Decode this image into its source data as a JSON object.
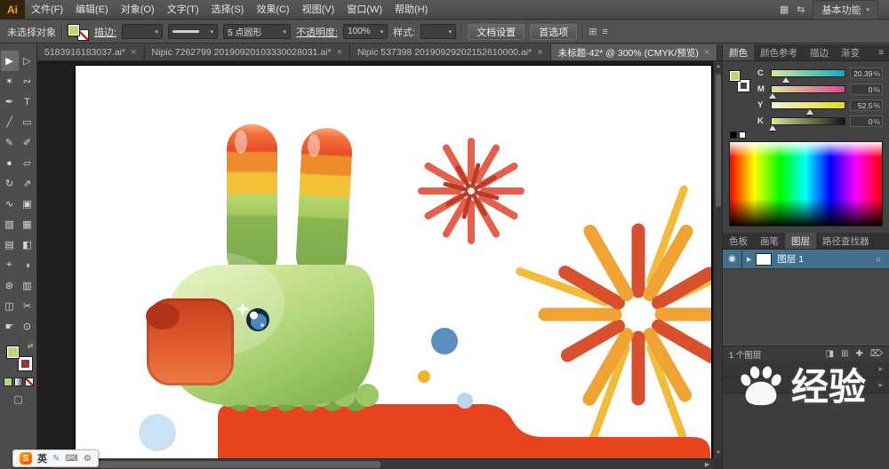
{
  "titlebar": {
    "logo": "Ai",
    "menus": [
      "文件(F)",
      "编辑(E)",
      "对象(O)",
      "文字(T)",
      "选择(S)",
      "效果(C)",
      "视图(V)",
      "窗口(W)",
      "帮助(H)"
    ],
    "icon_arrange": "▦",
    "icon_swap": "⇆",
    "workspace": "基本功能",
    "caret": "▾"
  },
  "control": {
    "no_selection": "未选择对象",
    "stroke_label": "描边:",
    "stroke_value": "",
    "brush_value": "5 点圆形",
    "opacity_label": "不透明度:",
    "opacity_value": "100%",
    "style_label": "样式:",
    "btn_doc_setup": "文档设置",
    "btn_preferences": "首选项",
    "caret": "▾",
    "icon_menu": "≡",
    "icon_grid": "⊞"
  },
  "doc_tabs": {
    "tabs": [
      {
        "label": "5183916183037.ai*"
      },
      {
        "label": "Nipic 7262799 20190920103330028031.ai*"
      },
      {
        "label": "Nipic 537398 20190929202152610000.ai*"
      },
      {
        "label": "未标题-42* @ 300% (CMYK/预览)"
      }
    ],
    "close_glyph": "×",
    "overflow_glyph": "»",
    "menu_glyph": "≡"
  },
  "toolbar": {
    "tools": [
      {
        "name": "selection",
        "glyph": "▶"
      },
      {
        "name": "direct-selection",
        "glyph": "▷"
      },
      {
        "name": "magic-wand",
        "glyph": "✶"
      },
      {
        "name": "lasso",
        "glyph": "∾"
      },
      {
        "name": "pen",
        "glyph": "✒"
      },
      {
        "name": "type",
        "glyph": "T"
      },
      {
        "name": "line-segment",
        "glyph": "╱"
      },
      {
        "name": "rectangle",
        "glyph": "▭"
      },
      {
        "name": "paintbrush",
        "glyph": "✎"
      },
      {
        "name": "pencil",
        "glyph": "✐"
      },
      {
        "name": "blob-brush",
        "glyph": "●"
      },
      {
        "name": "eraser",
        "glyph": "▱"
      },
      {
        "name": "rotate",
        "glyph": "↻"
      },
      {
        "name": "scale",
        "glyph": "⇗"
      },
      {
        "name": "width",
        "glyph": "∿"
      },
      {
        "name": "free-transform",
        "glyph": "▣"
      },
      {
        "name": "shape-builder",
        "glyph": "▨"
      },
      {
        "name": "perspective-grid",
        "glyph": "▦"
      },
      {
        "name": "mesh",
        "glyph": "▤"
      },
      {
        "name": "gradient",
        "glyph": "◧"
      },
      {
        "name": "eyedropper",
        "glyph": "⌖"
      },
      {
        "name": "blend",
        "glyph": "◑"
      },
      {
        "name": "symbol-sprayer",
        "glyph": "⊛"
      },
      {
        "name": "column-graph",
        "glyph": "▥"
      },
      {
        "name": "artboard",
        "glyph": "◫"
      },
      {
        "name": "slice",
        "glyph": "✂"
      },
      {
        "name": "hand",
        "glyph": "☛"
      },
      {
        "name": "zoom",
        "glyph": "⊙"
      }
    ],
    "swap_glyph": "⇄",
    "screen_mode_glyph": "▢"
  },
  "color_panel": {
    "tabs": [
      "颜色",
      "颜色参考",
      "描边",
      "渐变"
    ],
    "menu_glyph": "≡",
    "sliders": [
      {
        "channel": "C",
        "value": "20.39"
      },
      {
        "channel": "M",
        "value": "0"
      },
      {
        "channel": "Y",
        "value": "52.5"
      },
      {
        "channel": "K",
        "value": "0"
      }
    ],
    "percent_sign": "%"
  },
  "panels": {
    "tabs": [
      "色板",
      "画笔",
      "图层",
      "路径查找器"
    ],
    "collapsed_chevron": "▸"
  },
  "layers": {
    "rows": [
      {
        "name": "图层 1"
      }
    ],
    "status": "1 个图层",
    "eye_glyph": "◉",
    "expand_glyph": "▶",
    "target_glyph": "○",
    "footer_icons": [
      "◨",
      "⊞",
      "✚",
      "⌦"
    ]
  },
  "scrollbars": {
    "left": "◀",
    "right": "▶",
    "up": "▲",
    "down": "▼"
  },
  "ime_bar": {
    "logo": "S",
    "lang": "英",
    "icons": [
      "✎",
      "⌨",
      "⚙"
    ]
  },
  "watermark": {
    "text": "经验"
  },
  "artwork": {
    "description": "Cartoon llama with rainbow striped ears, red muzzle, green head, red body, fireworks and dots on white artboard",
    "palette": {
      "ear_tip_red": "#e84d22",
      "ear_orange": "#ee8c2d",
      "ear_yellow": "#f2c134",
      "ear_green": "#86b350",
      "head_light": "#e2f2b4",
      "head_green": "#86b853",
      "muzzle_red": "#d94a24",
      "body_red": "#e8431f",
      "firework_coral": "#e4604a",
      "firework_dark_red": "#bd3a28",
      "firework_orange": "#f0a232",
      "firework_yellow": "#f3bb3a",
      "dot_blue": "#5b8fc0",
      "dot_yellow": "#f0b429",
      "dot_light_blue": "#c9e3f3",
      "eye_blue": "#4f86b8"
    }
  }
}
